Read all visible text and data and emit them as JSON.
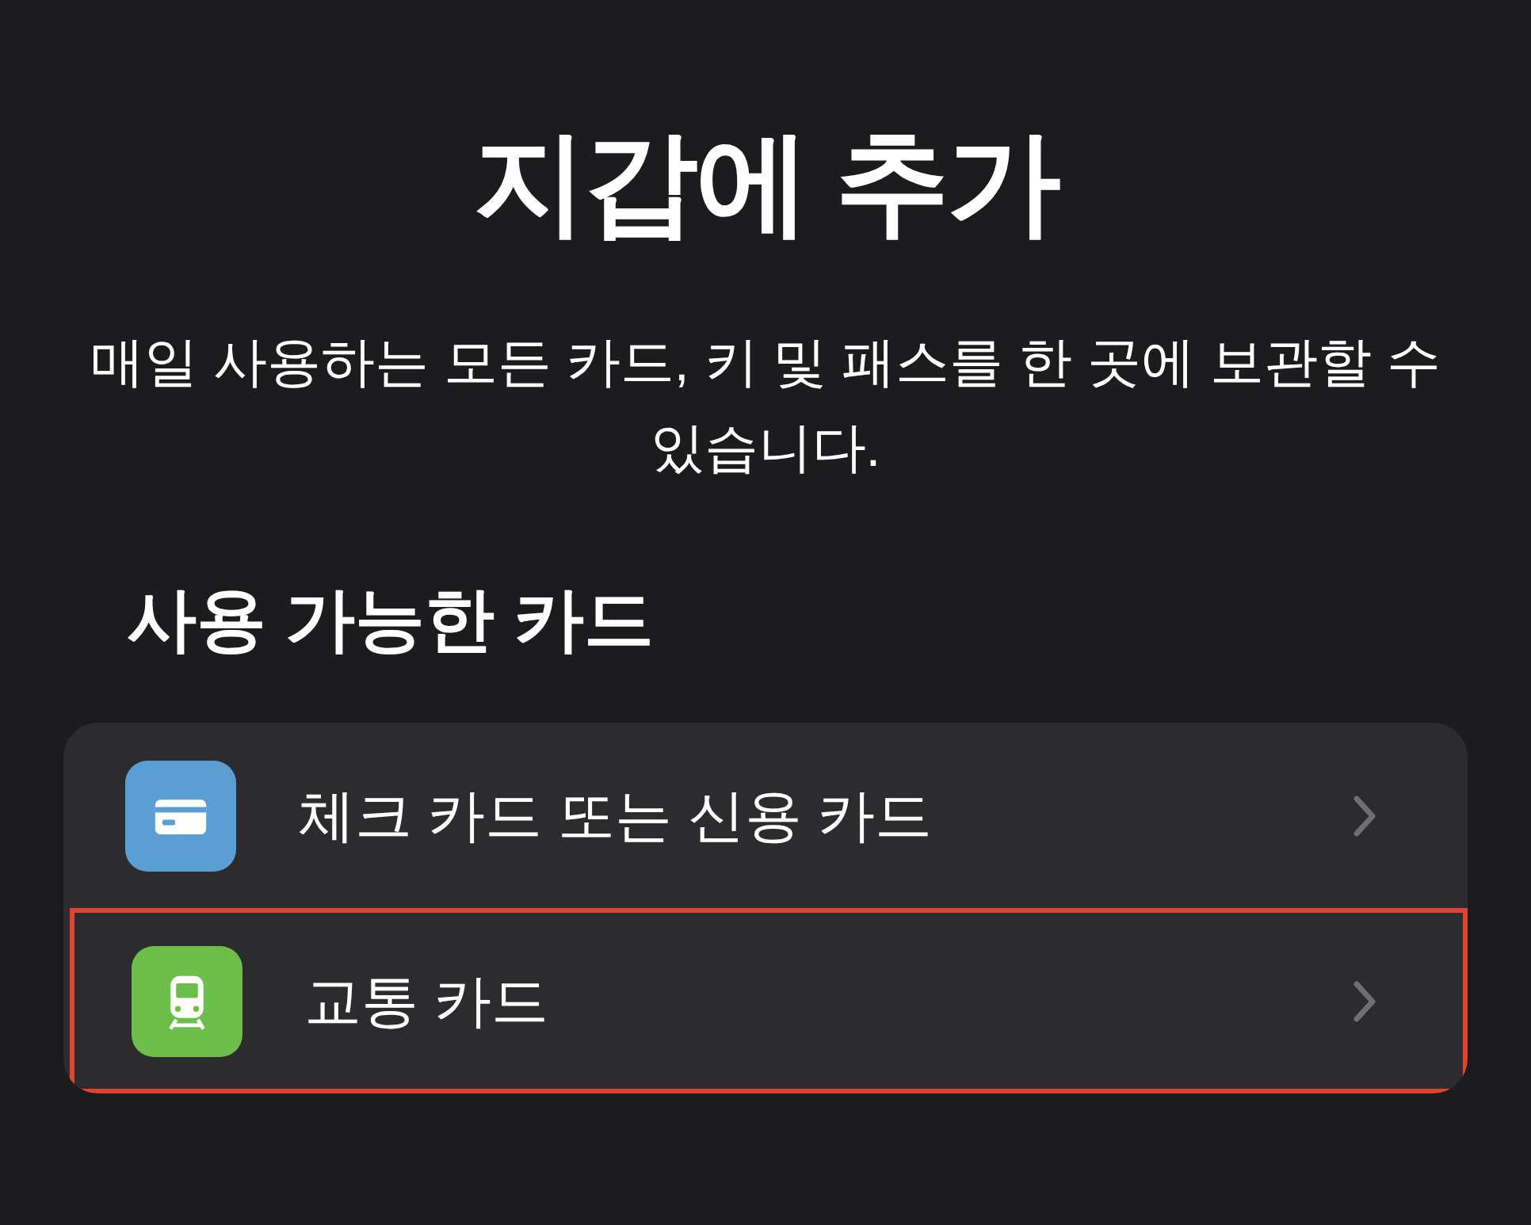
{
  "title": "지갑에 추가",
  "description": "매일 사용하는 모든 카드, 키 및 패스를 한 곳에 보관할 수 있습니다.",
  "section": {
    "heading": "사용 가능한 카드",
    "items": [
      {
        "kind": "card",
        "label": "체크 카드 또는 신용 카드",
        "highlighted": false
      },
      {
        "kind": "transit",
        "label": "교통 카드",
        "highlighted": true
      }
    ]
  }
}
